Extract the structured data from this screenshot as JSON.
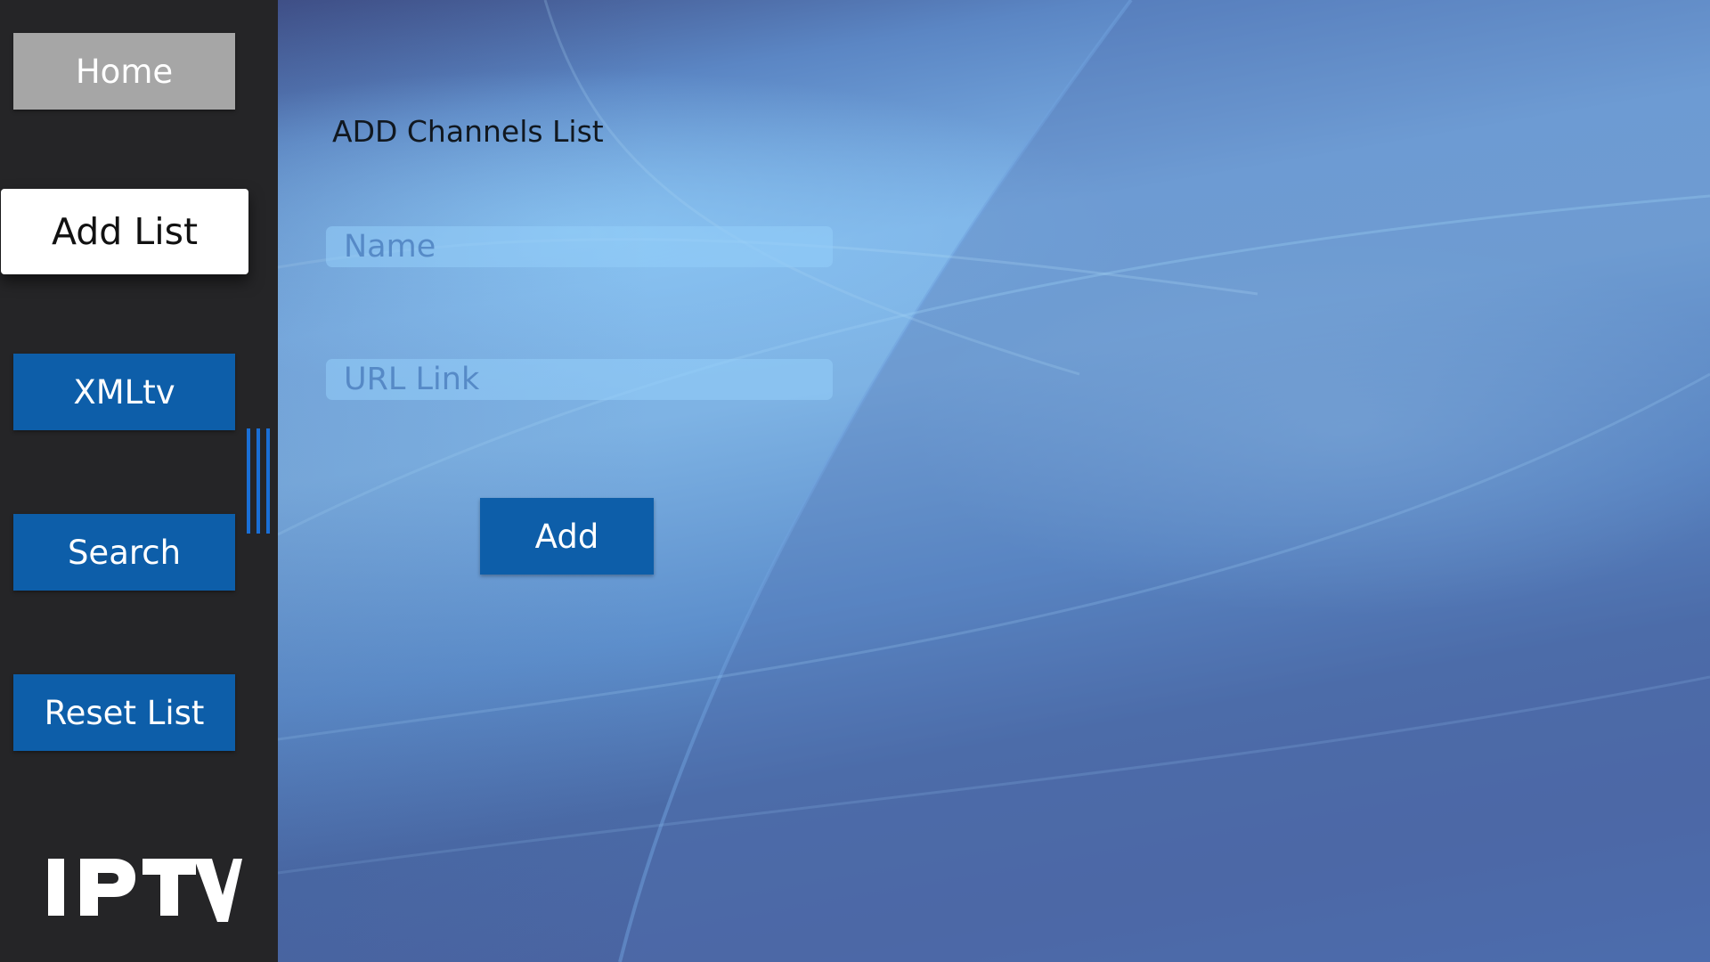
{
  "sidebar": {
    "items": [
      {
        "label": "Home",
        "state": "normal"
      },
      {
        "label": "Add List",
        "state": "focused"
      },
      {
        "label": "XMLtv",
        "state": "normal"
      },
      {
        "label": "Search",
        "state": "normal"
      },
      {
        "label": "Reset List",
        "state": "normal"
      }
    ],
    "logo_text": "IPTV"
  },
  "form": {
    "title": "ADD Channels List",
    "name_placeholder": "Name",
    "name_value": "",
    "url_placeholder": "URL Link",
    "url_value": "",
    "add_label": "Add"
  },
  "colors": {
    "sidebar_bg": "#252527",
    "button_blue": "#0d5ea9",
    "home_button_gray": "#a6a6a6",
    "focused_button_bg": "#ffffff",
    "handle_blue": "#1a6fd6"
  },
  "icons": {
    "handle": "drag-handle-icon",
    "logo": "iptv-logo"
  }
}
